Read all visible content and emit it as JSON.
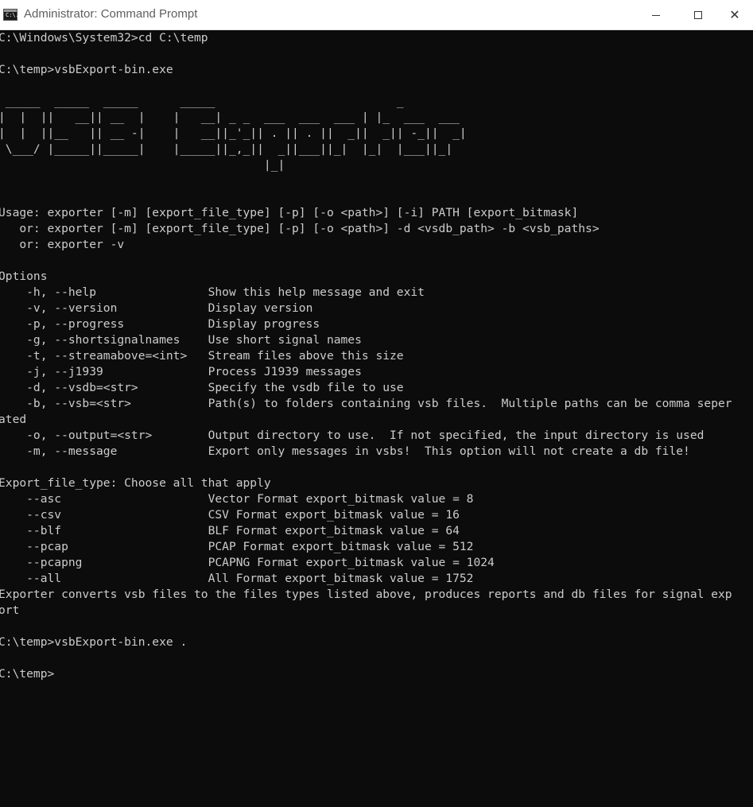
{
  "window": {
    "title": "Administrator: Command Prompt",
    "icon": "cmd-icon",
    "icon_glyph": "C:\\.",
    "controls": {
      "minimize": "minimize-icon",
      "maximize": "maximize-icon",
      "close": "close-icon"
    }
  },
  "console": {
    "text_color": "#cccccc",
    "background": "#0c0c0c",
    "lines": [
      "C:\\Windows\\System32>cd C:\\temp",
      "",
      "C:\\temp>vsbExport-bin.exe",
      "",
      " _____  _____  _____      _____                          _",
      "|  |  ||   __|| __  |    |   __| _ _  ___  ___  ___ | |_  ___  ___",
      "|  |  ||__   || __ -|    |   __||_'_|| . || . ||  _||  _|| -_||  _|",
      " \\___/ |_____||_____|    |_____||_,_||  _||___||_|  |_|  |___||_|",
      "                                      |_|",
      "",
      "",
      "Usage: exporter [-m] [export_file_type] [-p] [-o <path>] [-i] PATH [export_bitmask]",
      "   or: exporter [-m] [export_file_type] [-p] [-o <path>] -d <vsdb_path> -b <vsb_paths>",
      "   or: exporter -v",
      "",
      "Options",
      "    -h, --help                Show this help message and exit",
      "    -v, --version             Display version",
      "    -p, --progress            Display progress",
      "    -g, --shortsignalnames    Use short signal names",
      "    -t, --streamabove=<int>   Stream files above this size",
      "    -j, --j1939               Process J1939 messages",
      "    -d, --vsdb=<str>          Specify the vsdb file to use",
      "    -b, --vsb=<str>           Path(s) to folders containing vsb files.  Multiple paths can be comma seper",
      "ated",
      "    -o, --output=<str>        Output directory to use.  If not specified, the input directory is used",
      "    -m, --message             Export only messages in vsbs!  This option will not create a db file!",
      "",
      "Export_file_type: Choose all that apply",
      "    --asc                     Vector Format export_bitmask value = 8",
      "    --csv                     CSV Format export_bitmask value = 16",
      "    --blf                     BLF Format export_bitmask value = 64",
      "    --pcap                    PCAP Format export_bitmask value = 512",
      "    --pcapng                  PCAPNG Format export_bitmask value = 1024",
      "    --all                     All Format export_bitmask value = 1752",
      "Exporter converts vsb files to the files types listed above, produces reports and db files for signal exp",
      "ort",
      "",
      "C:\\temp>vsbExport-bin.exe .",
      "",
      "C:\\temp>"
    ]
  }
}
